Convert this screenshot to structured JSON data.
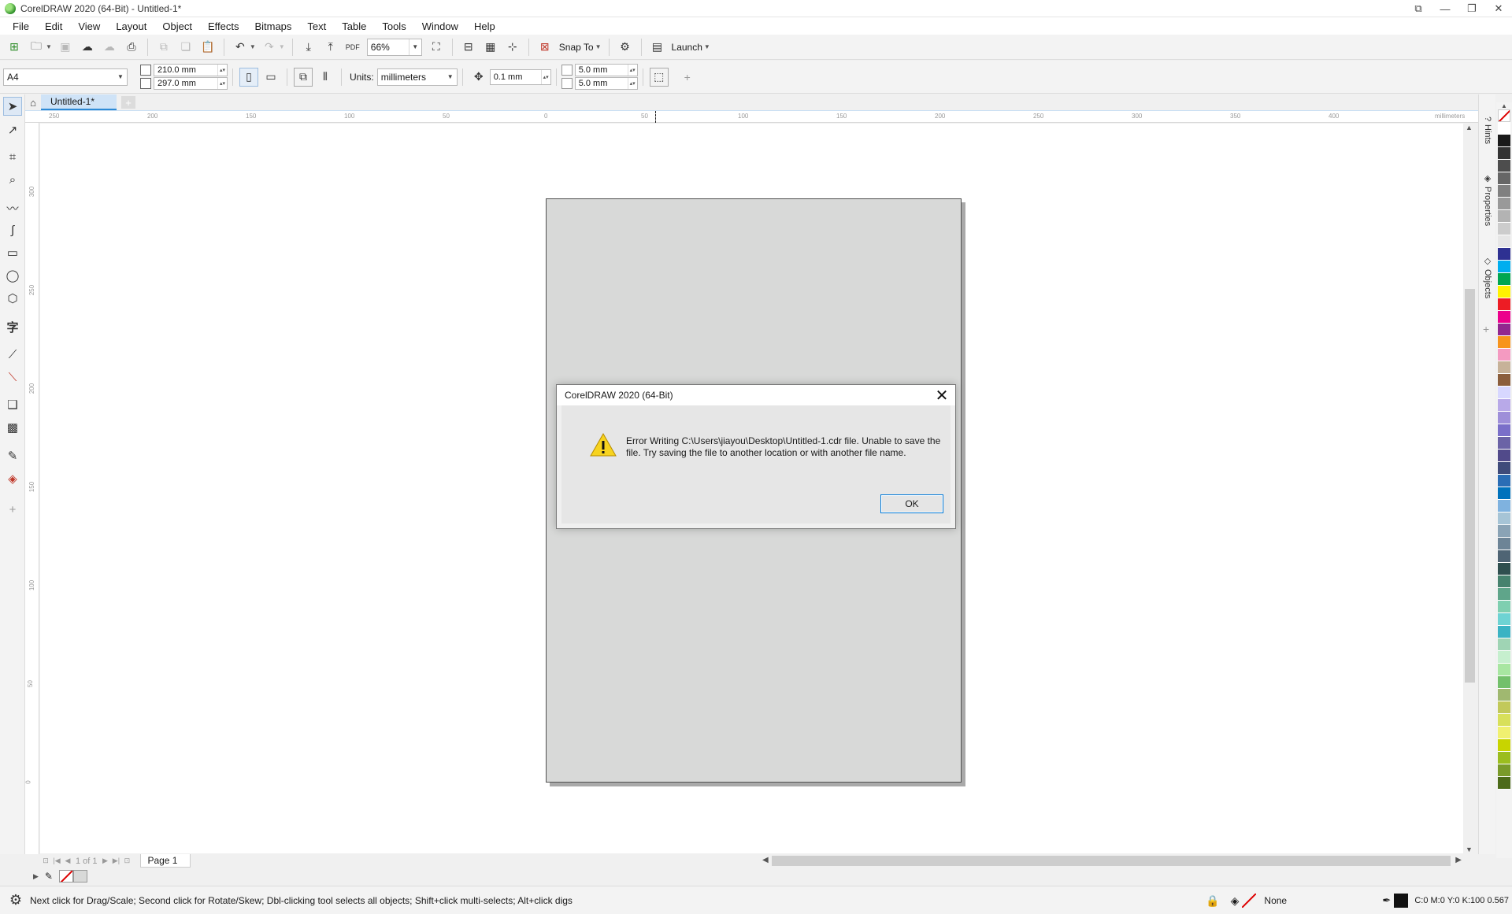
{
  "window": {
    "title": "CorelDRAW 2020 (64-Bit) - Untitled-1*"
  },
  "menu": [
    "File",
    "Edit",
    "View",
    "Layout",
    "Object",
    "Effects",
    "Bitmaps",
    "Text",
    "Table",
    "Tools",
    "Window",
    "Help"
  ],
  "toolbar": {
    "zoom": "66%",
    "snap_to": "Snap To",
    "launch": "Launch"
  },
  "propbar": {
    "page_size": "A4",
    "width": "210.0 mm",
    "height": "297.0 mm",
    "units_label": "Units:",
    "units": "millimeters",
    "nudge": "0.1 mm",
    "dup_x": "5.0 mm",
    "dup_y": "5.0 mm"
  },
  "doc": {
    "tab": "Untitled-1*"
  },
  "ruler": {
    "h_ticks": [
      "250",
      "200",
      "150",
      "100",
      "50",
      "0",
      "50",
      "100",
      "150",
      "200",
      "250",
      "300",
      "350",
      "400"
    ],
    "unit": "millimeters",
    "v_ticks": [
      "300",
      "250",
      "200",
      "150",
      "100",
      "50",
      "0"
    ]
  },
  "dockers": [
    "Hints",
    "Properties",
    "Objects"
  ],
  "palette": [
    "#ffffff",
    "#1a1a1a",
    "#333333",
    "#4d4d4d",
    "#666666",
    "#808080",
    "#999999",
    "#b3b3b3",
    "#cccccc",
    "#e6e6e6",
    "#2e3192",
    "#00aeef",
    "#00a651",
    "#fff200",
    "#ed1c24",
    "#ec008c",
    "#92278f",
    "#f7941d",
    "#f49ac1",
    "#c7b299",
    "#8b5e3c",
    "#d7d7ff",
    "#b8a9e8",
    "#9e8fd9",
    "#7a6fc9",
    "#6b63a6",
    "#514a8a",
    "#3f4b7a",
    "#2a6db5",
    "#0072bc",
    "#7fb2df",
    "#a6c4d6",
    "#8aa3b5",
    "#6d8496",
    "#4f6474",
    "#2f4f4f",
    "#46826e",
    "#5fa58a",
    "#7fcfb0",
    "#6ed3d3",
    "#3bb3c3",
    "#9fd4b4",
    "#c6efce",
    "#a8e6a1",
    "#73c06b",
    "#a0b870",
    "#c2c95a",
    "#d8e05a",
    "#f0f070",
    "#c8d400",
    "#9bbd1e",
    "#7a9a2a",
    "#4d6b1a"
  ],
  "pager": {
    "current": "1",
    "of": "of",
    "total": "1",
    "page_tab": "Page 1"
  },
  "status": {
    "hint": "Next click for Drag/Scale; Second click for Rotate/Skew; Dbl-clicking tool selects all objects; Shift+click multi-selects; Alt+click digs",
    "fill": "None",
    "outline": "C:0 M:0 Y:0 K:100  0.567"
  },
  "dialog": {
    "title": "CorelDRAW 2020 (64-Bit)",
    "message": "Error Writing C:\\Users\\jiayou\\Desktop\\Untitled-1.cdr file. Unable to save the file. Try saving the file to another location or with another file name.",
    "ok": "OK"
  }
}
